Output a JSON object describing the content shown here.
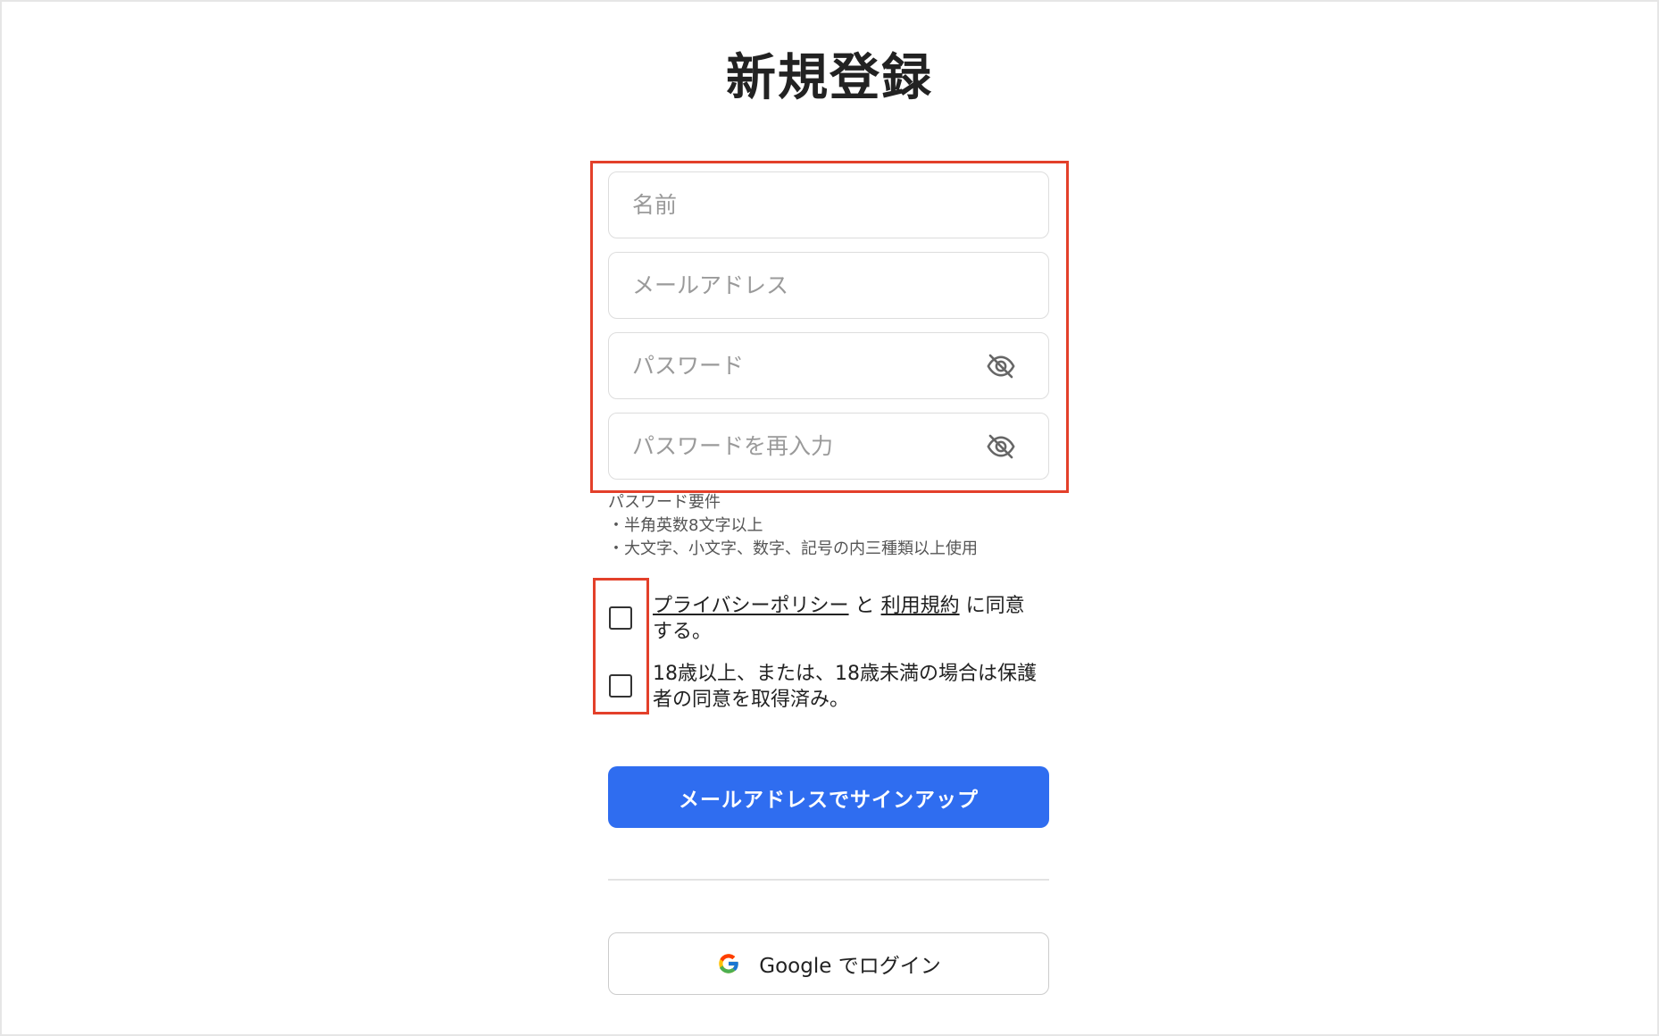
{
  "page": {
    "title": "新規登録"
  },
  "form": {
    "name_placeholder": "名前",
    "email_placeholder": "メールアドレス",
    "password_placeholder": "パスワード",
    "password_confirm_placeholder": "パスワードを再入力"
  },
  "password_requirements": {
    "heading": "パスワード要件",
    "items": [
      "・半角英数8文字以上",
      "・大文字、小文字、数字、記号の内三種類以上使用"
    ]
  },
  "agreements": {
    "privacy_link": "プライバシーポリシー",
    "and_text": " と ",
    "terms_link": "利用規約",
    "agree_suffix": " に同意する。",
    "age_text": "18歳以上、または、18歳未満の場合は保護者の同意を取得済み。"
  },
  "actions": {
    "email_signup_label": "メールアドレスでサインアップ",
    "google_login_label": "Google でログイン"
  },
  "colors": {
    "primary": "#2f6df0",
    "annotation_red": "#e3402a"
  },
  "icons": {
    "password_toggle": "eye-off-icon",
    "google": "google-icon"
  }
}
